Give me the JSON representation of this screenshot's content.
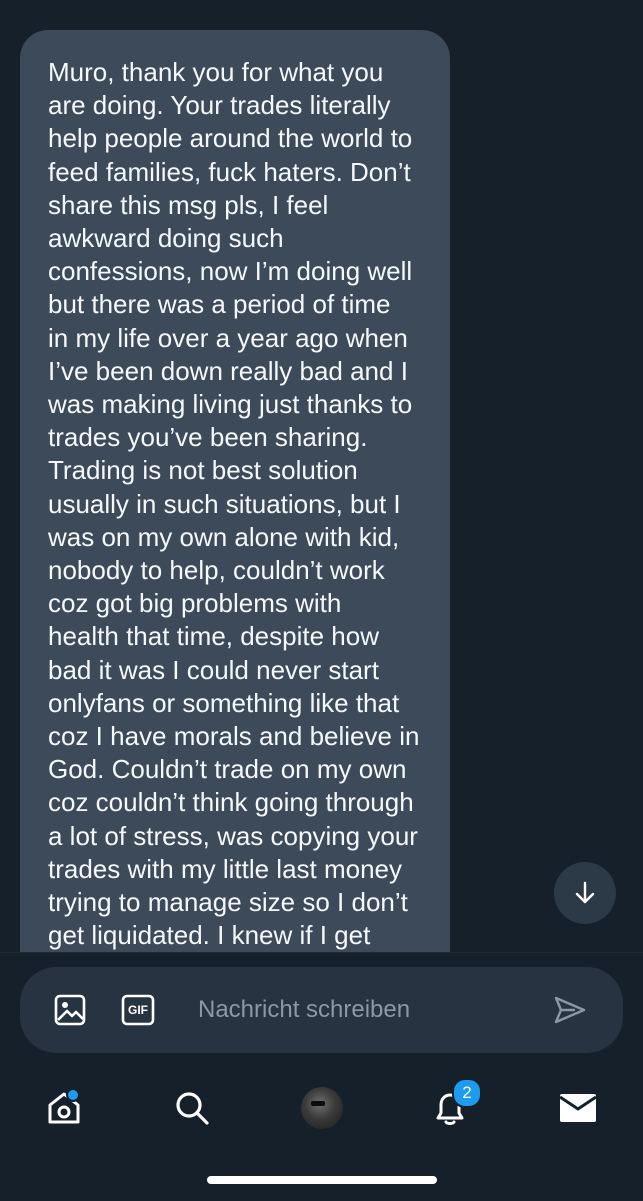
{
  "message": {
    "lines": [
      "Muro, thank you for what you",
      "are doing. Your trades literally",
      "help people around the world to",
      "feed families, fuck haters. Don’t",
      "share this msg pls, I feel",
      "awkward doing such",
      "confessions, now I’m doing well",
      "but there was a period of time",
      "in my life over a year ago when",
      "I’ve been down really bad and I",
      "was making living just thanks to",
      "trades you’ve been sharing.",
      "Trading is not best solution",
      "usually in such situations, but I",
      "was on my own alone with kid,",
      "nobody to help, couldn’t work",
      "coz got big problems with",
      "health that time, despite how",
      "bad it was I could never start",
      "onlyfans or something like that",
      "coz I have morals and believe in",
      "God. Couldn’t trade on my own",
      "coz couldn’t think going through",
      "a lot of stress, was copying your",
      "trades with my little last money",
      "trying to manage size so I don’t",
      "get liquidated. I knew if I get"
    ]
  },
  "scroll_button": {
    "icon": "arrow-down-icon"
  },
  "composer": {
    "image_icon": "image-icon",
    "gif_label": "GIF",
    "placeholder": "Nachricht schreiben",
    "send_icon": "send-icon"
  },
  "bottom_nav": {
    "home_icon": "home-icon",
    "search_icon": "search-icon",
    "profile_icon": "avatar",
    "notifications_icon": "bell-icon",
    "notifications_count": "2",
    "messages_icon": "envelope-icon"
  },
  "colors": {
    "background": "#15202b",
    "bubble": "#3c4a59",
    "composer": "#273340",
    "accent": "#1d9bf0",
    "placeholder": "#8b98a5"
  }
}
